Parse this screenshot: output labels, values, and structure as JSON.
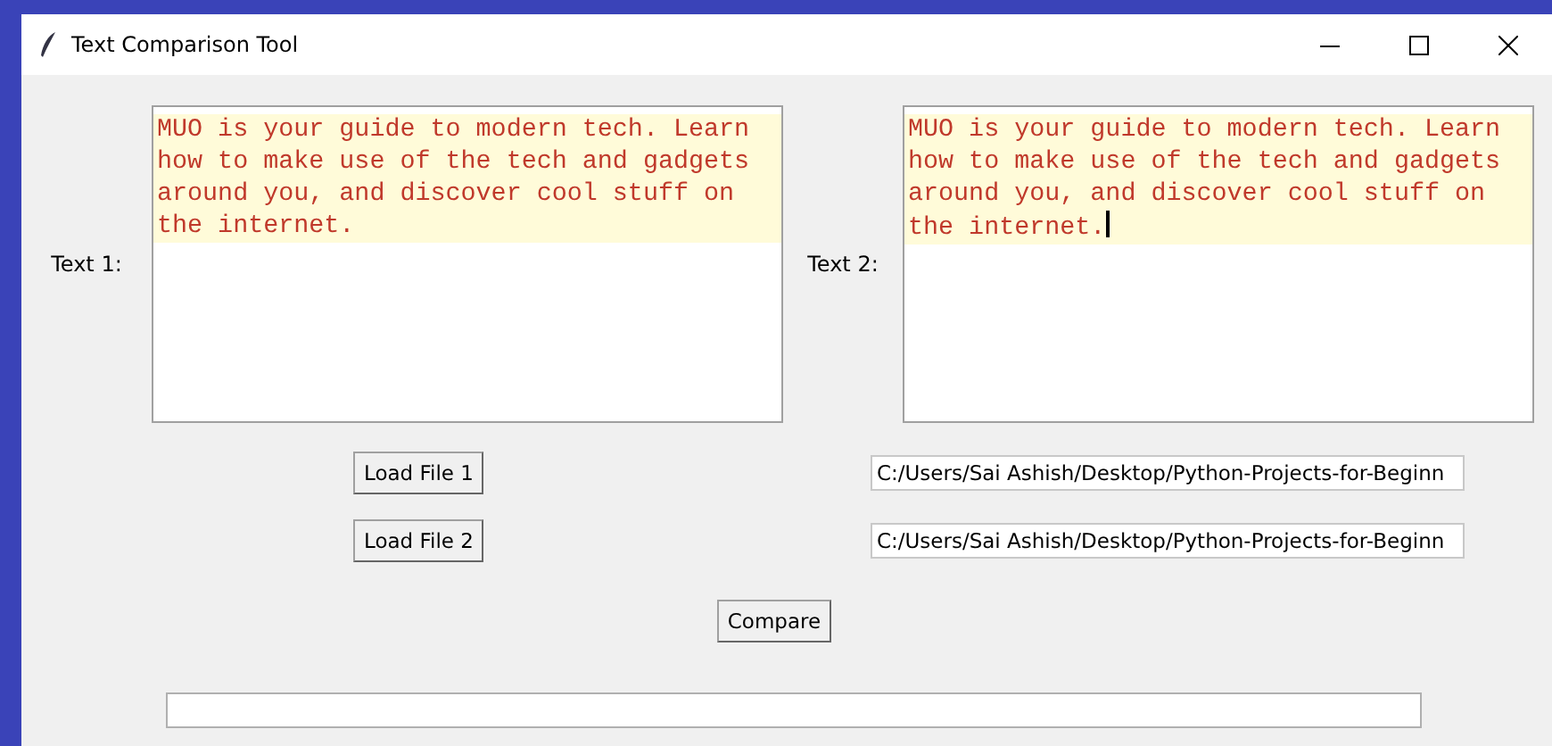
{
  "window": {
    "title": "Text Comparison Tool"
  },
  "text_panels": [
    {
      "label": "Text 1:",
      "highlighted": true,
      "focused": false,
      "lines": [
        "MUO is your guide to modern tech. Learn",
        "how to make use of the tech and gadgets",
        "around you, and discover cool stuff on",
        "the internet."
      ]
    },
    {
      "label": "Text 2:",
      "highlighted": true,
      "focused": true,
      "lines": [
        "MUO is your guide to modern tech. Learn",
        "how to make use of the tech and gadgets",
        "around you, and discover cool stuff on",
        "the internet."
      ]
    }
  ],
  "file_rows": [
    {
      "button": "Load File 1",
      "path": "C:/Users/Sai Ashish/Desktop/Python-Projects-for-Beginn"
    },
    {
      "button": "Load File 2",
      "path": "C:/Users/Sai Ashish/Desktop/Python-Projects-for-Beginn"
    }
  ],
  "compare_button": "Compare"
}
